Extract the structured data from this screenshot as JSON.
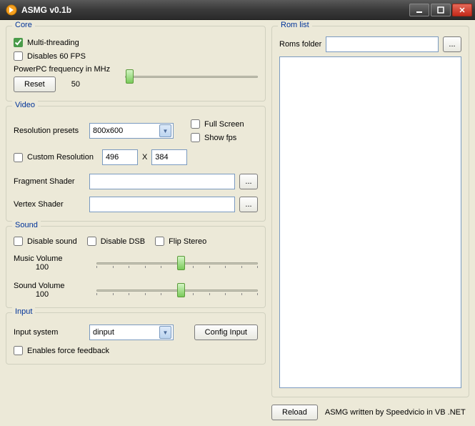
{
  "window": {
    "title": "ASMG v0.1b"
  },
  "core": {
    "legend": "Core",
    "multi_threading_label": "Multi-threading",
    "multi_threading_checked": true,
    "disables_60fps_label": "Disables 60 FPS",
    "disables_60fps_checked": false,
    "freq_label": "PowerPC frequency in MHz",
    "freq_value": "50",
    "reset_label": "Reset"
  },
  "video": {
    "legend": "Video",
    "resolution_presets_label": "Resolution presets",
    "resolution_presets_value": "800x600",
    "full_screen_label": "Full Screen",
    "full_screen_checked": false,
    "show_fps_label": "Show fps",
    "show_fps_checked": false,
    "custom_resolution_label": "Custom Resolution",
    "custom_resolution_checked": false,
    "custom_w": "496",
    "x_label": "X",
    "custom_h": "384",
    "fragment_shader_label": "Fragment Shader",
    "fragment_shader_value": "",
    "vertex_shader_label": "Vertex Shader",
    "vertex_shader_value": "",
    "browse_label": "..."
  },
  "sound": {
    "legend": "Sound",
    "disable_sound_label": "Disable sound",
    "disable_sound_checked": false,
    "disable_dsb_label": "Disable DSB",
    "disable_dsb_checked": false,
    "flip_stereo_label": "Flip Stereo",
    "flip_stereo_checked": false,
    "music_volume_label": "Music Volume",
    "music_volume_value": "100",
    "sound_volume_label": "Sound Volume",
    "sound_volume_value": "100"
  },
  "input": {
    "legend": "Input",
    "input_system_label": "Input system",
    "input_system_value": "dinput",
    "config_input_label": "Config Input",
    "force_feedback_label": "Enables force feedback",
    "force_feedback_checked": false
  },
  "romlist": {
    "legend": "Rom list",
    "roms_folder_label": "Roms folder",
    "roms_folder_value": "",
    "browse_label": "...",
    "reload_label": "Reload",
    "credits": "ASMG written by Speedvicio in VB .NET"
  }
}
